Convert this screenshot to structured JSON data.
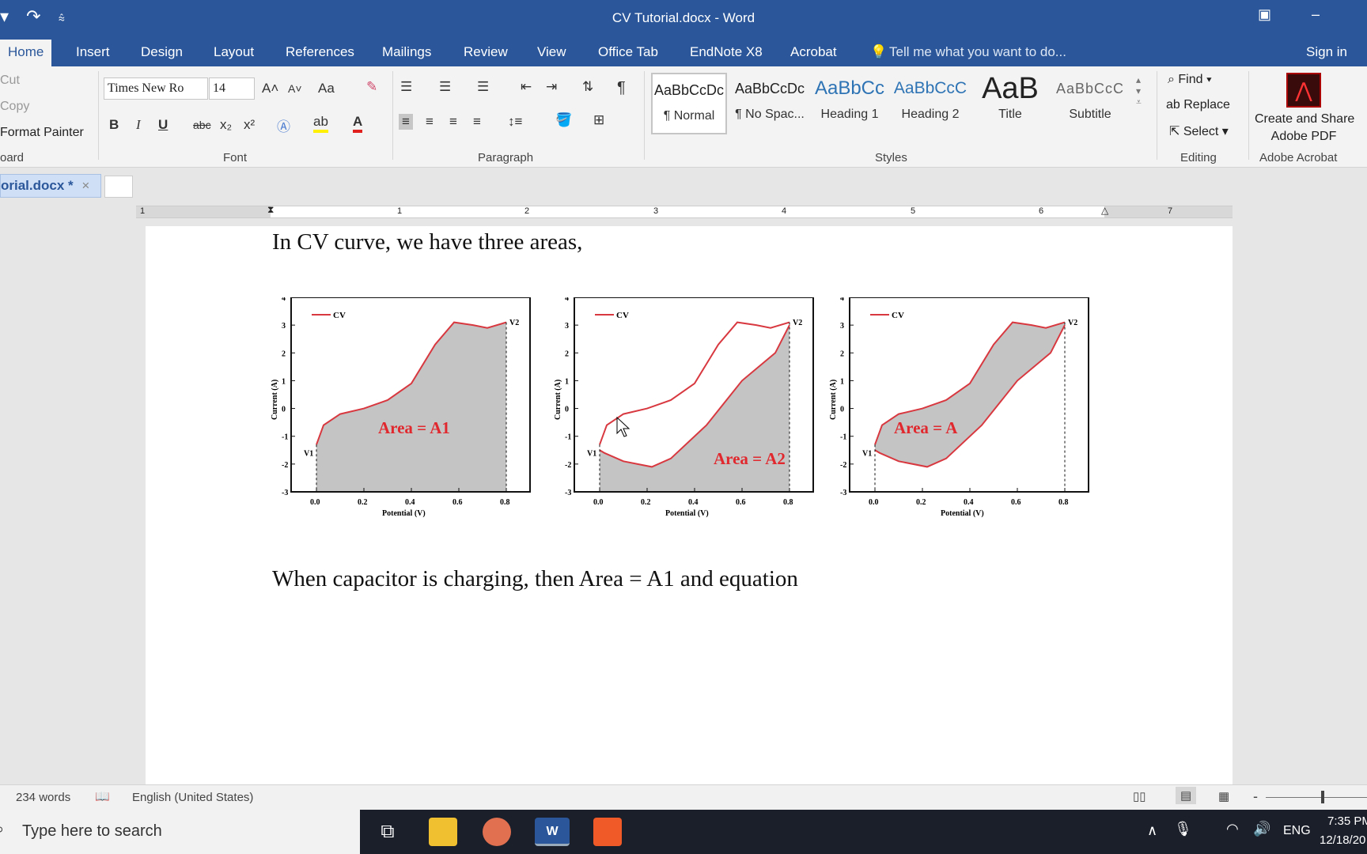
{
  "window": {
    "title": "CV Tutorial.docx - Word",
    "minimize": "–",
    "restore": "▣",
    "close": "✕"
  },
  "qat": {
    "undo_icon": "undo-icon",
    "redo": "↷",
    "customize": "⫯"
  },
  "menu": {
    "tabs": [
      "Home",
      "Insert",
      "Design",
      "Layout",
      "References",
      "Mailings",
      "Review",
      "View",
      "Office Tab",
      "EndNote X8",
      "Acrobat"
    ],
    "tell_me": "Tell me what you want to do...",
    "sign_in": "Sign in"
  },
  "clipboard": {
    "cut": "Cut",
    "copy": "Copy",
    "format_painter": "Format Painter",
    "label": "oard"
  },
  "font": {
    "name": "Times New Ro",
    "size": "14",
    "grow": "A˄",
    "shrink": "A˅",
    "case": "Aa",
    "bold": "B",
    "italic": "I",
    "underline": "U",
    "strike": "abc",
    "sub": "x₂",
    "sup": "x²",
    "label": "Font"
  },
  "paragraph": {
    "label": "Paragraph",
    "pilcrow": "¶"
  },
  "styles": {
    "label": "Styles",
    "items": [
      {
        "preview": "AaBbCcDc",
        "name": "¶ Normal"
      },
      {
        "preview": "AaBbCcDc",
        "name": "¶ No Spac..."
      },
      {
        "preview": "AaBbCc",
        "name": "Heading 1"
      },
      {
        "preview": "AaBbCcC",
        "name": "Heading 2"
      },
      {
        "preview": "AaB",
        "name": "Title"
      },
      {
        "preview": "AaBbCcC",
        "name": "Subtitle"
      }
    ]
  },
  "editing": {
    "find": "Find",
    "replace": "Replace",
    "select": "Select",
    "label": "Editing"
  },
  "acrobat": {
    "create_line1": "Create and Share",
    "create_line2": "Adobe PDF",
    "label": "Adobe Acrobat"
  },
  "doc_tab": {
    "name": "orial.docx *",
    "close": "×"
  },
  "ruler": {
    "numbers": [
      "1",
      "1",
      "2",
      "3",
      "4",
      "5",
      "6",
      "7"
    ]
  },
  "document": {
    "para1": "In CV curve, we have three areas,",
    "para2": "When capacitor is charging, then Area = A1 and equation"
  },
  "figures": {
    "legend": "CV",
    "xlabel": "Potential (V)",
    "ylabel": "Current (A)",
    "xticks": [
      "0.0",
      "0.2",
      "0.4",
      "0.6",
      "0.8"
    ],
    "yticks": [
      "4",
      "3",
      "2",
      "1",
      "0",
      "-1",
      "-2",
      "-3"
    ],
    "v1": "V1",
    "v2": "V2",
    "panels": [
      {
        "area_label": "Area = A1"
      },
      {
        "area_label": "Area = A2"
      },
      {
        "area_label": "Area = A"
      }
    ]
  },
  "status": {
    "words": "234 words",
    "language": "English (United States)",
    "zoom_minus": "-"
  },
  "taskbar": {
    "search": "Type here to search",
    "lang": "ENG",
    "time": "7:35 PM",
    "date": "12/18/20"
  }
}
